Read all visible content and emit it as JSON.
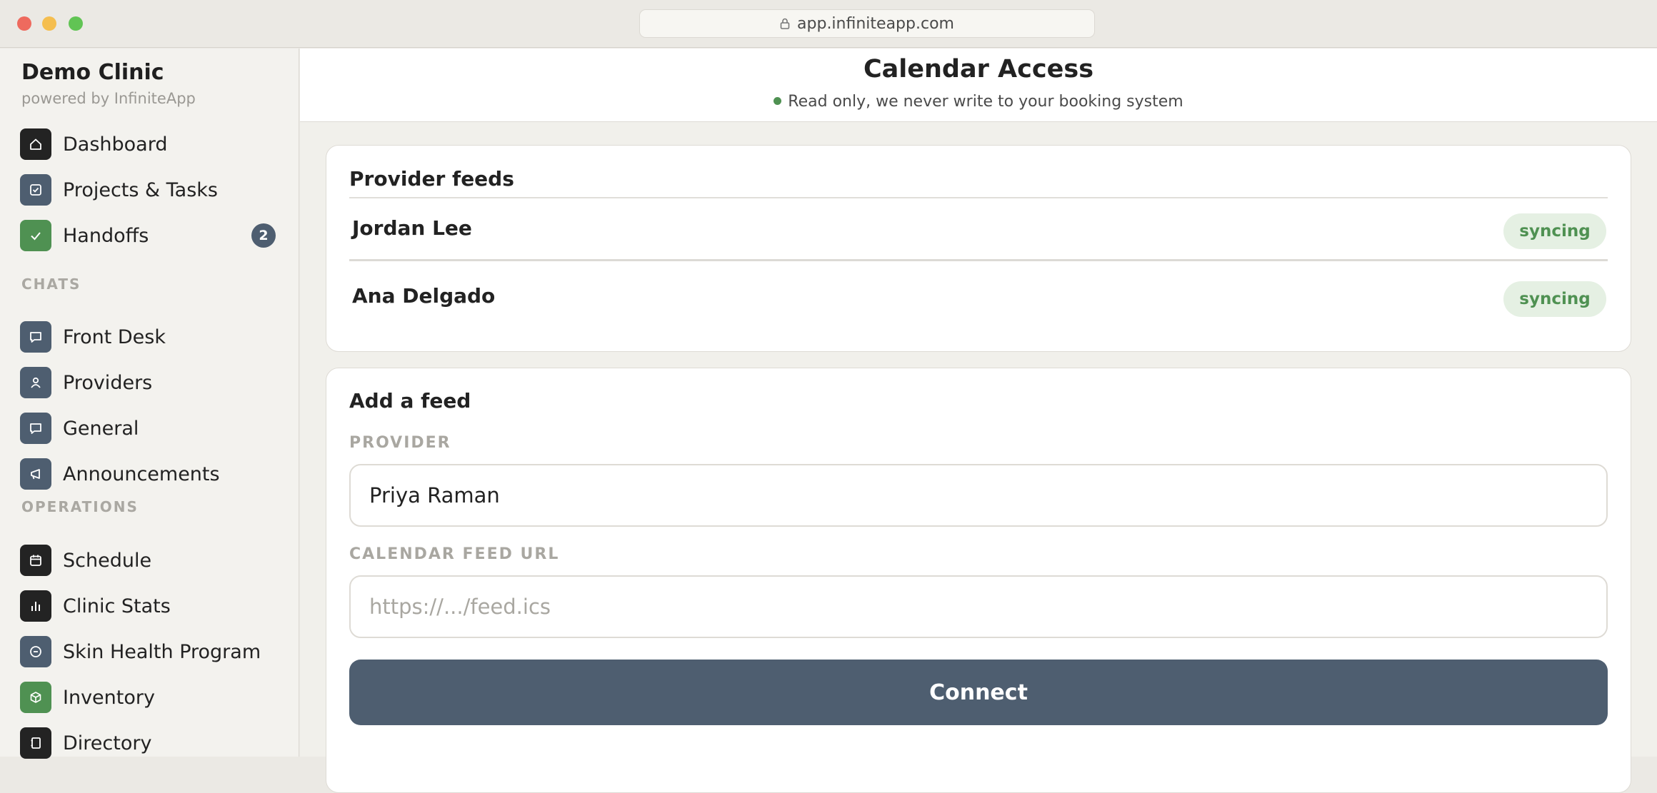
{
  "browser": {
    "url": "app.infiniteapp.com"
  },
  "sidebar": {
    "brand": {
      "title": "Demo Clinic",
      "subtitle": "powered by InfiniteApp"
    },
    "main_items": [
      {
        "label": "Dashboard",
        "icon": "home-icon"
      },
      {
        "label": "Projects & Tasks",
        "icon": "checkbox-icon"
      },
      {
        "label": "Handoffs",
        "icon": "check-icon",
        "badge": "2"
      }
    ],
    "chats_heading": "CHATS",
    "chats": [
      {
        "label": "Front Desk",
        "icon": "chat-bubble-icon"
      },
      {
        "label": "Providers",
        "icon": "person-icon"
      },
      {
        "label": "General",
        "icon": "chat-bubble-icon"
      },
      {
        "label": "Announcements",
        "icon": "megaphone-icon"
      }
    ],
    "operations_heading": "OPERATIONS",
    "operations": [
      {
        "label": "Schedule",
        "icon": "calendar-icon"
      },
      {
        "label": "Clinic Stats",
        "icon": "bar-chart-icon"
      },
      {
        "label": "Skin Health Program",
        "icon": "circle-minus-icon"
      },
      {
        "label": "Inventory",
        "icon": "box-icon"
      },
      {
        "label": "Directory",
        "icon": "book-icon"
      }
    ]
  },
  "header": {
    "title": "Calendar Access",
    "subtitle": "Read only, we never write to your booking system",
    "status_color": "#4f9152"
  },
  "provider_feeds": {
    "title": "Provider feeds",
    "feeds": [
      {
        "name": "Jordan Lee",
        "status": "syncing"
      },
      {
        "name": "Ana Delgado",
        "status": "syncing"
      }
    ]
  },
  "add_feed": {
    "title": "Add a feed",
    "provider_label": "PROVIDER",
    "provider_value": "Priya Raman",
    "url_label": "CALENDAR FEED URL",
    "url_placeholder": "https://.../feed.ics",
    "connect_label": "Connect"
  },
  "colors": {
    "accent_slate": "#4e5e70",
    "accent_green": "#4f9152",
    "icon_dark": "#232323"
  }
}
